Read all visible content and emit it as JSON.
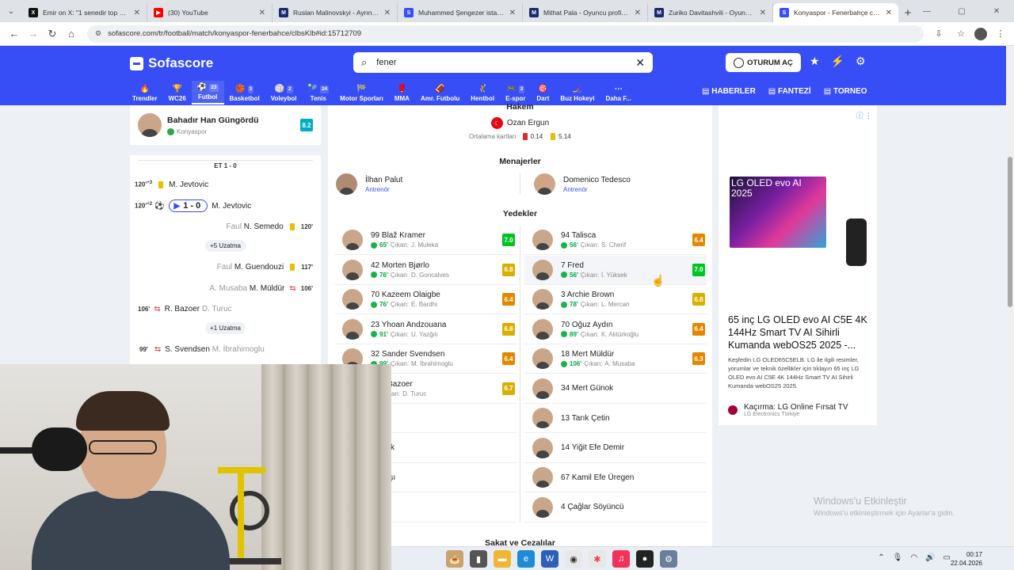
{
  "browser": {
    "tabs": [
      {
        "label": "Emir on X: \"1 senedir top oyna...",
        "fav_color": "#111111",
        "fav_text": "X"
      },
      {
        "label": "(30) YouTube",
        "fav_color": "#ff0000",
        "fav_text": "▶"
      },
      {
        "label": "Ruslan Malinovskyi - Ayrıntılı p...",
        "fav_color": "#1a2b6d",
        "fav_text": "M"
      },
      {
        "label": "Muhammed Şengezer istatistik...",
        "fav_color": "#374df5",
        "fav_text": "S"
      },
      {
        "label": "Mithat Pala - Oyuncu profili 25/...",
        "fav_color": "#1a2b6d",
        "fav_text": "M"
      },
      {
        "label": "Zuriko Davitashvili - Oyuncu pr...",
        "fav_color": "#1a2b6d",
        "fav_text": "M"
      },
      {
        "label": "Konyaspor - Fenerbahçe canlı s...",
        "fav_color": "#374df5",
        "fav_text": "S"
      }
    ],
    "url": "sofascore.com/tr/football/match/konyaspor-fenerbahce/clbsKlb#id:15712709"
  },
  "header": {
    "logo": "Sofascore",
    "search_value": "fener",
    "login": "OTURUM AÇ",
    "sports": [
      {
        "label": "Trendler",
        "icon": "🔥",
        "count": ""
      },
      {
        "label": "WC26",
        "icon": "🏆",
        "count": ""
      },
      {
        "label": "Futbol",
        "icon": "⚽",
        "count": "23"
      },
      {
        "label": "Basketbol",
        "icon": "🏀",
        "count": "3"
      },
      {
        "label": "Voleybol",
        "icon": "🏐",
        "count": "2"
      },
      {
        "label": "Tenis",
        "icon": "🎾",
        "count": "24"
      },
      {
        "label": "Motor Sporları",
        "icon": "🏁",
        "count": ""
      },
      {
        "label": "MMA",
        "icon": "🥊",
        "count": ""
      },
      {
        "label": "Amr. Futbolu",
        "icon": "🏈",
        "count": ""
      },
      {
        "label": "Hentbol",
        "icon": "🤾",
        "count": ""
      },
      {
        "label": "E-spor",
        "icon": "🎮",
        "count": "3"
      },
      {
        "label": "Dart",
        "icon": "🎯",
        "count": ""
      },
      {
        "label": "Buz Hokeyi",
        "icon": "🏒",
        "count": ""
      },
      {
        "label": "Daha F...",
        "icon": "⋯",
        "count": ""
      }
    ],
    "links": [
      "HABERLER",
      "FANTEZİ",
      "TORNEO"
    ]
  },
  "left": {
    "top_player": {
      "name": "Bahadır Han Güngördü",
      "team": "Konyaspor",
      "rating": "8.2"
    },
    "et_header": "ET 1 - 0",
    "events": [
      {
        "min": "120'",
        "sup": "+3",
        "type": "yellow",
        "text": "M. Jevtovic",
        "side": "left"
      },
      {
        "min": "120'",
        "sup": "+2",
        "type": "goal",
        "score": "1 - 0",
        "text": "M. Jevtovic",
        "side": "left"
      },
      {
        "min": "120'",
        "type": "yellow",
        "pre": "Faul",
        "text": "N. Semedo",
        "side": "right"
      },
      {
        "min": "117'",
        "type": "yellow",
        "pre": "Faul",
        "text": "M. Guendouzi",
        "side": "right"
      },
      {
        "min": "106'",
        "type": "sub",
        "pre": "A. Musaba",
        "text": "M. Müldür",
        "side": "right"
      },
      {
        "min": "106'",
        "type": "sub",
        "text": "R. Bazoer",
        "post": "D. Turuc",
        "side": "left"
      },
      {
        "min": "99'",
        "type": "sub",
        "text": "S. Svendsen",
        "post": "M. İbrahimoglu",
        "side": "left"
      }
    ],
    "extra1": "+5 Uzatma",
    "extra2": "+1 Uzatma"
  },
  "main": {
    "referee_title": "Hakem",
    "referee": "Ozan Ergun",
    "ref_stats_label": "Ortalama kartları",
    "ref_red": "0.14",
    "ref_yellow": "5.14",
    "managers_title": "Menajerler",
    "manager_home": {
      "name": "İlhan Palut",
      "role": "Antrenör"
    },
    "manager_away": {
      "name": "Domenico Tedesco",
      "role": "Antrenör"
    },
    "subs_title": "Yedekler",
    "home_subs": [
      {
        "name": "99 Blaž Kramer",
        "in": "65'",
        "out_label": "Çıkan:",
        "out": "J. Muleka",
        "rating": "7.0",
        "rc": "r-green"
      },
      {
        "name": "42 Morten Bjørlo",
        "in": "76'",
        "out_label": "Çıkan:",
        "out": "D. Goncalves",
        "rating": "6.8",
        "rc": "r-yellow"
      },
      {
        "name": "70 Kazeem Olaigbe",
        "in": "76'",
        "out_label": "Çıkan:",
        "out": "E. Bardhi",
        "rating": "6.4",
        "rc": "r-orange"
      },
      {
        "name": "23 Yhoan Andzouana",
        "in": "91'",
        "out_label": "Çıkan:",
        "out": "U. Yazğılı",
        "rating": "6.8",
        "rc": "r-yellow"
      },
      {
        "name": "32 Sander Svendsen",
        "in": "99'",
        "out_label": "Çıkan:",
        "out": "M. İbrahimoglu",
        "rating": "6.4",
        "rc": "r-orange"
      },
      {
        "name": "edly Bazoer",
        "in": "",
        "out_label": "Çıkan:",
        "out": "D. Turuc",
        "rating": "6.7",
        "rc": "r-yellow"
      },
      {
        "name": "Ertaş",
        "in": "",
        "out_label": "",
        "out": "",
        "rating": "",
        "rc": ""
      },
      {
        "name": "Boşluk",
        "in": "",
        "out_label": "",
        "out": "",
        "rating": "",
        "rc": ""
      },
      {
        "name": "Subaşı",
        "in": "",
        "out_label": "",
        "out": "",
        "rating": "",
        "rc": ""
      },
      {
        "name": "n-ho",
        "in": "",
        "out_label": "",
        "out": "",
        "rating": "",
        "rc": ""
      }
    ],
    "away_subs": [
      {
        "name": "94 Talisca",
        "in": "56'",
        "out_label": "Çıkan:",
        "out": "S. Cherif",
        "rating": "6.4",
        "rc": "r-orange"
      },
      {
        "name": "7 Fred",
        "in": "56'",
        "out_label": "Çıkan:",
        "out": "İ. Yüksek",
        "rating": "7.0",
        "rc": "r-green"
      },
      {
        "name": "3 Archie Brown",
        "in": "78'",
        "out_label": "Çıkan:",
        "out": "L. Mercan",
        "rating": "6.8",
        "rc": "r-yellow"
      },
      {
        "name": "70 Oğuz Aydın",
        "in": "89'",
        "out_label": "Çıkan:",
        "out": "K. Aktürkoğlu",
        "rating": "6.4",
        "rc": "r-orange"
      },
      {
        "name": "18 Mert Müldür",
        "in": "106'",
        "out_label": "Çıkan:",
        "out": "A. Musaba",
        "rating": "6.3",
        "rc": "r-orange"
      },
      {
        "name": "34 Mert Günok",
        "in": "",
        "out_label": "",
        "out": "",
        "rating": "",
        "rc": ""
      },
      {
        "name": "13 Tarık Çetin",
        "in": "",
        "out_label": "",
        "out": "",
        "rating": "",
        "rc": ""
      },
      {
        "name": "14 Yiğit Efe Demir",
        "in": "",
        "out_label": "",
        "out": "",
        "rating": "",
        "rc": ""
      },
      {
        "name": "67 Kamil Efe Üregen",
        "in": "",
        "out_label": "",
        "out": "",
        "rating": "",
        "rc": ""
      },
      {
        "name": "4 Çağlar Söyüncü",
        "in": "",
        "out_label": "",
        "out": "",
        "rating": "",
        "rc": ""
      }
    ],
    "injuries_title": "Sakat ve Cezalılar"
  },
  "ad": {
    "tv_text": "LG OLED evo AI\n2025",
    "title": "65 inç LG OLED evo AI C5E 4K 144Hz Smart TV AI Sihirli Kumanda webOS25 2025 -...",
    "text": "Keşfedin LG OLED65C5ELB. LG ile ilgili resimler, yorumlar ve teknik özellikler için tıklayın 65 inç LG OLED evo AI C5E 4K 144Hz Smart TV AI Sihirli Kumanda webOS25 2025.",
    "brand_title": "Kaçırma: LG Online Fırsat TV",
    "brand_sub": "LG Electronics Türkiye"
  },
  "watermark": {
    "line1": "Windows'u Etkinleştir",
    "line2": "Windows'u etkinleştirmek için Ayarlar'a gidin."
  },
  "taskbar": {
    "time": "00:17",
    "date": "22.04.2026"
  }
}
